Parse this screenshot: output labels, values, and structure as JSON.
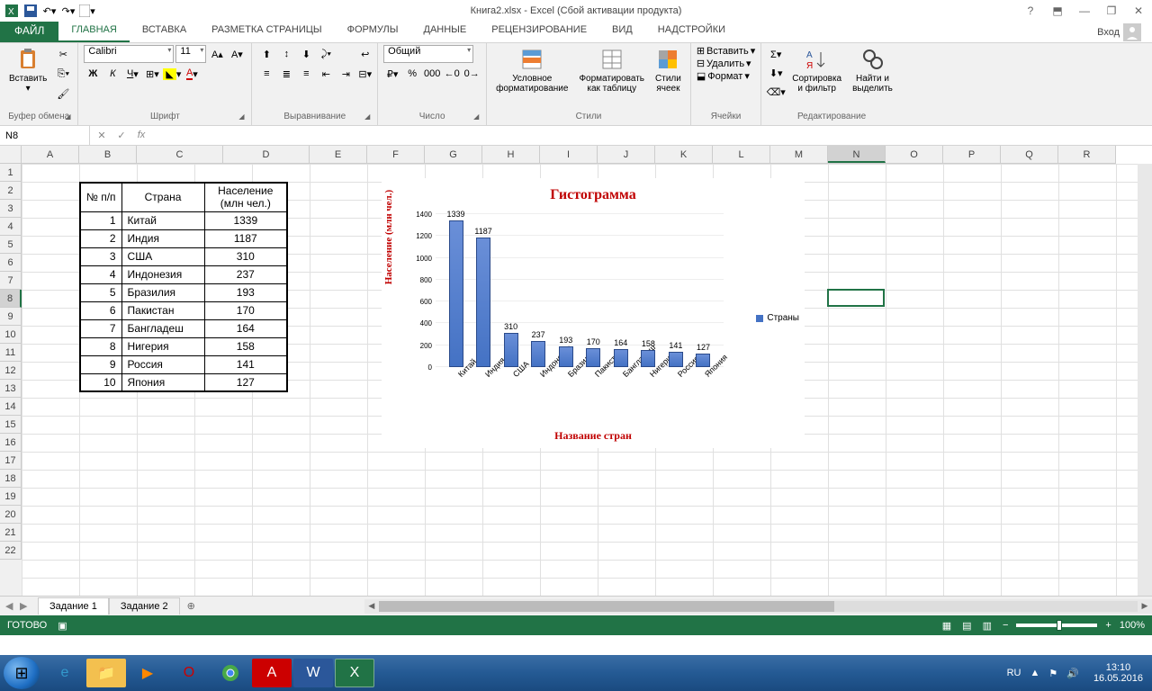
{
  "titlebar": {
    "title": "Книга2.xlsx - Excel (Сбой активации продукта)"
  },
  "tabs": {
    "file": "ФАЙЛ",
    "items": [
      "ГЛАВНАЯ",
      "ВСТАВКА",
      "РАЗМЕТКА СТРАНИЦЫ",
      "ФОРМУЛЫ",
      "ДАННЫЕ",
      "РЕЦЕНЗИРОВАНИЕ",
      "ВИД",
      "НАДСТРОЙКИ"
    ],
    "login": "Вход"
  },
  "ribbon": {
    "clipboard": {
      "paste": "Вставить",
      "label": "Буфер обмена"
    },
    "font": {
      "name": "Calibri",
      "size": "11",
      "label": "Шрифт"
    },
    "alignment": {
      "label": "Выравнивание"
    },
    "number": {
      "format": "Общий",
      "label": "Число"
    },
    "styles": {
      "cond": "Условное\nформатирование",
      "table": "Форматировать\nкак таблицу",
      "cell": "Стили\nячеек",
      "label": "Стили"
    },
    "cells": {
      "insert": "Вставить",
      "delete": "Удалить",
      "format": "Формат",
      "label": "Ячейки"
    },
    "editing": {
      "sort": "Сортировка\nи фильтр",
      "find": "Найти и\nвыделить",
      "label": "Редактирование"
    }
  },
  "formulabar": {
    "cell": "N8"
  },
  "columns": [
    "A",
    "B",
    "C",
    "D",
    "E",
    "F",
    "G",
    "H",
    "I",
    "J",
    "K",
    "L",
    "M",
    "N",
    "O",
    "P",
    "Q",
    "R"
  ],
  "rows_shown": 22,
  "active": {
    "row": 8,
    "col": "N"
  },
  "table": {
    "headers": [
      "№ п/п",
      "Страна",
      "Население\n(млн чел.)"
    ],
    "rows": [
      [
        1,
        "Китай",
        1339
      ],
      [
        2,
        "Индия",
        1187
      ],
      [
        3,
        "США",
        310
      ],
      [
        4,
        "Индонезия",
        237
      ],
      [
        5,
        "Бразилия",
        193
      ],
      [
        6,
        "Пакистан",
        170
      ],
      [
        7,
        "Бангладеш",
        164
      ],
      [
        8,
        "Нигерия",
        158
      ],
      [
        9,
        "Россия",
        141
      ],
      [
        10,
        "Япония",
        127
      ]
    ]
  },
  "chart_data": {
    "type": "bar",
    "title": "Гистограмма",
    "xlabel": "Название стран",
    "ylabel": "Население (млн чел.)",
    "ylim": [
      0,
      1400
    ],
    "yticks": [
      0,
      200,
      400,
      600,
      800,
      1000,
      1200,
      1400
    ],
    "categories": [
      "Китай",
      "Индия",
      "США",
      "Индонезия",
      "Бразилия",
      "Пакистан",
      "Бангладеш",
      "Нигерия",
      "Россия",
      "Япония"
    ],
    "values": [
      1339,
      1187,
      310,
      237,
      193,
      170,
      164,
      158,
      141,
      127
    ],
    "legend": "Страны"
  },
  "sheets": {
    "items": [
      "Задание 1",
      "Задание 2"
    ],
    "active": 0
  },
  "statusbar": {
    "ready": "ГОТОВО",
    "zoom": "100%"
  },
  "taskbar": {
    "lang": "RU",
    "time": "13:10",
    "date": "16.05.2016"
  }
}
